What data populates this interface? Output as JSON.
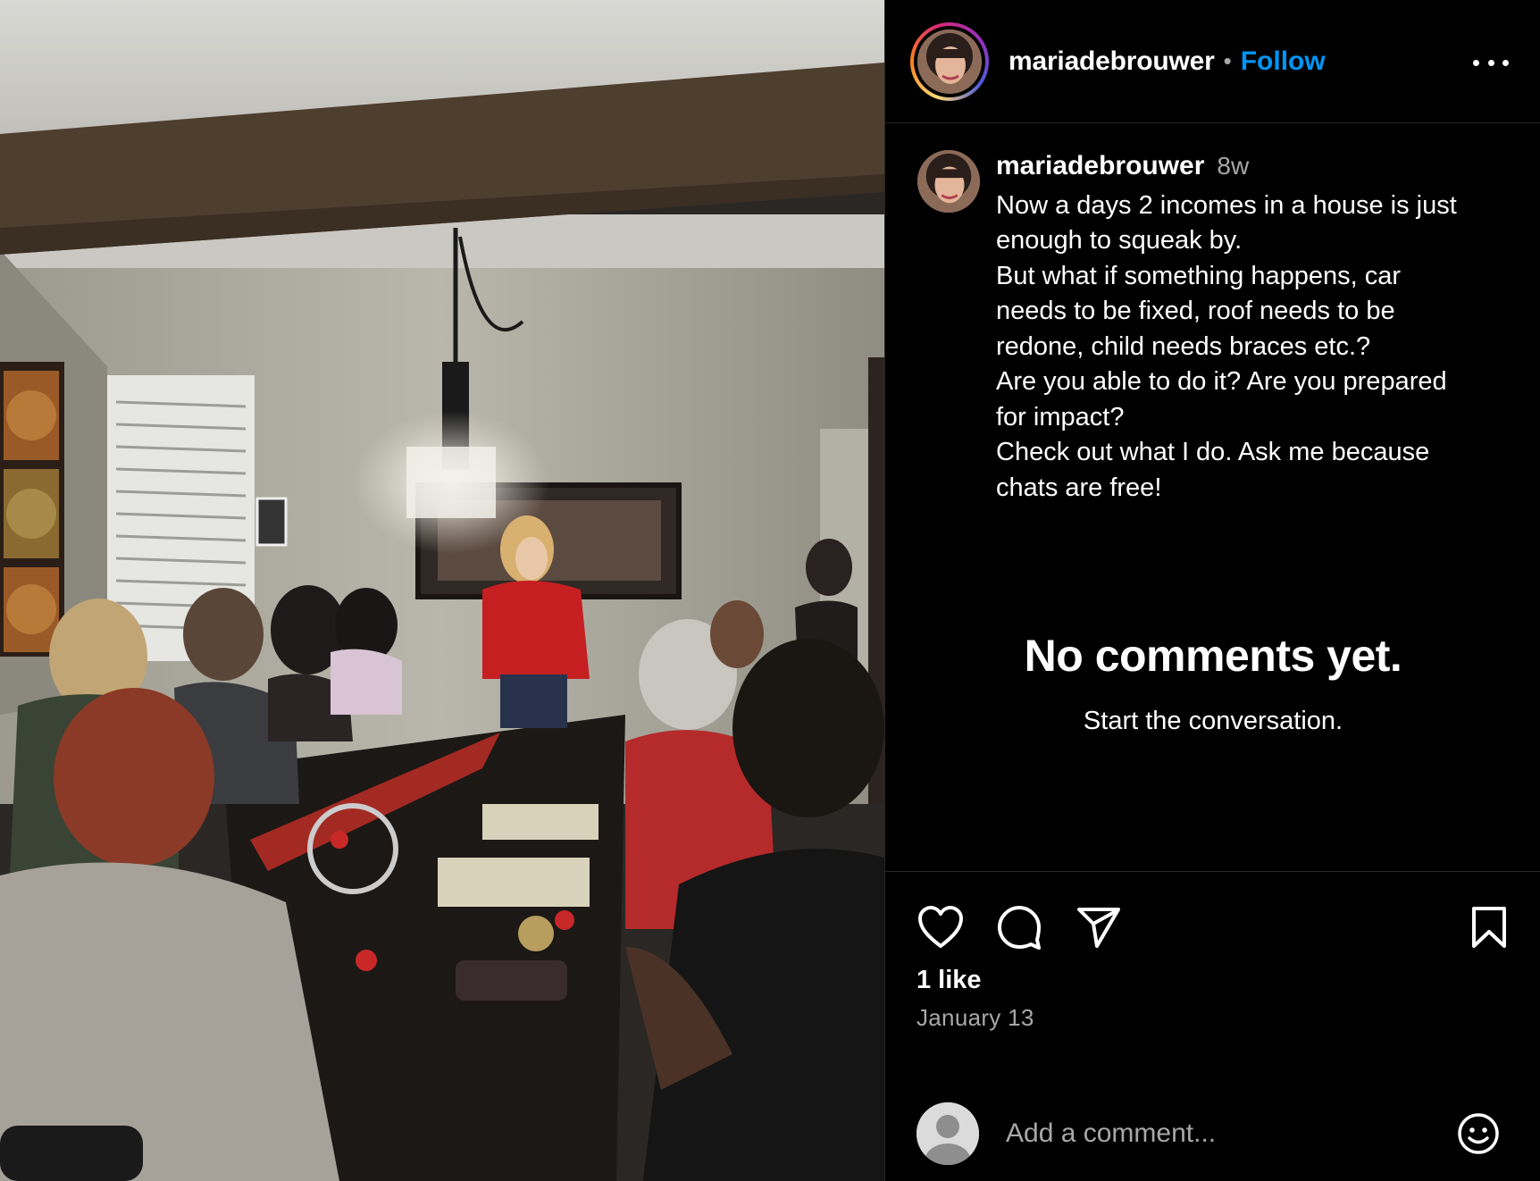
{
  "post": {
    "username": "mariadebrouwer",
    "separator": "•",
    "follow_label": "Follow",
    "more_label": "More options"
  },
  "caption": {
    "username": "mariadebrouwer",
    "time": "8w",
    "lines": [
      "Now a days 2 incomes in a house is just",
      "enough to squeak by.",
      "But what if something happens, car",
      "needs to be fixed, roof needs to be",
      "redone, child needs braces etc.?",
      "Are you able to do it? Are you prepared",
      "for impact?",
      "Check out what I do. Ask me because",
      "chats are free!"
    ]
  },
  "comments": {
    "empty_title": "No comments yet.",
    "empty_subtitle": "Start the conversation."
  },
  "actions": {
    "like_icon": "heart-icon",
    "comment_icon": "comment-bubble-icon",
    "share_icon": "paper-plane-icon",
    "save_icon": "bookmark-icon",
    "likes": "1 like",
    "date": "January 13"
  },
  "comment_box": {
    "placeholder": "Add a comment...",
    "emoji_icon": "smiley-icon"
  },
  "colors": {
    "background": "#000000",
    "link_blue": "#0095f6",
    "muted": "#a8a8a8",
    "divider": "#262626"
  }
}
